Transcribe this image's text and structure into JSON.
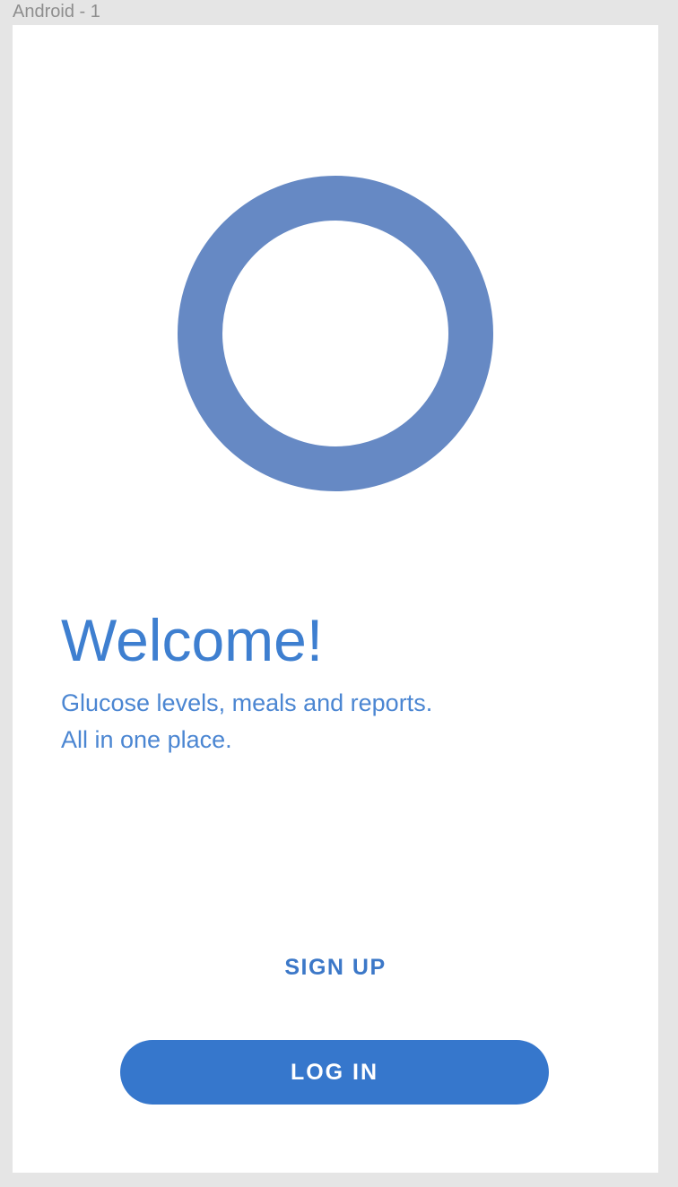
{
  "frame": {
    "label": "Android - 1"
  },
  "logo": {
    "icon": "ring-logo-icon",
    "color": "#6689c4"
  },
  "welcome": {
    "title": "Welcome!",
    "subtitle_lines": [
      "Glucose levels, meals and reports.",
      "All in one place."
    ],
    "title_color": "#3e7fd0"
  },
  "actions": {
    "signup_label": "SIGN UP",
    "login_label": "LOG IN",
    "login_color": "#3677cc"
  }
}
